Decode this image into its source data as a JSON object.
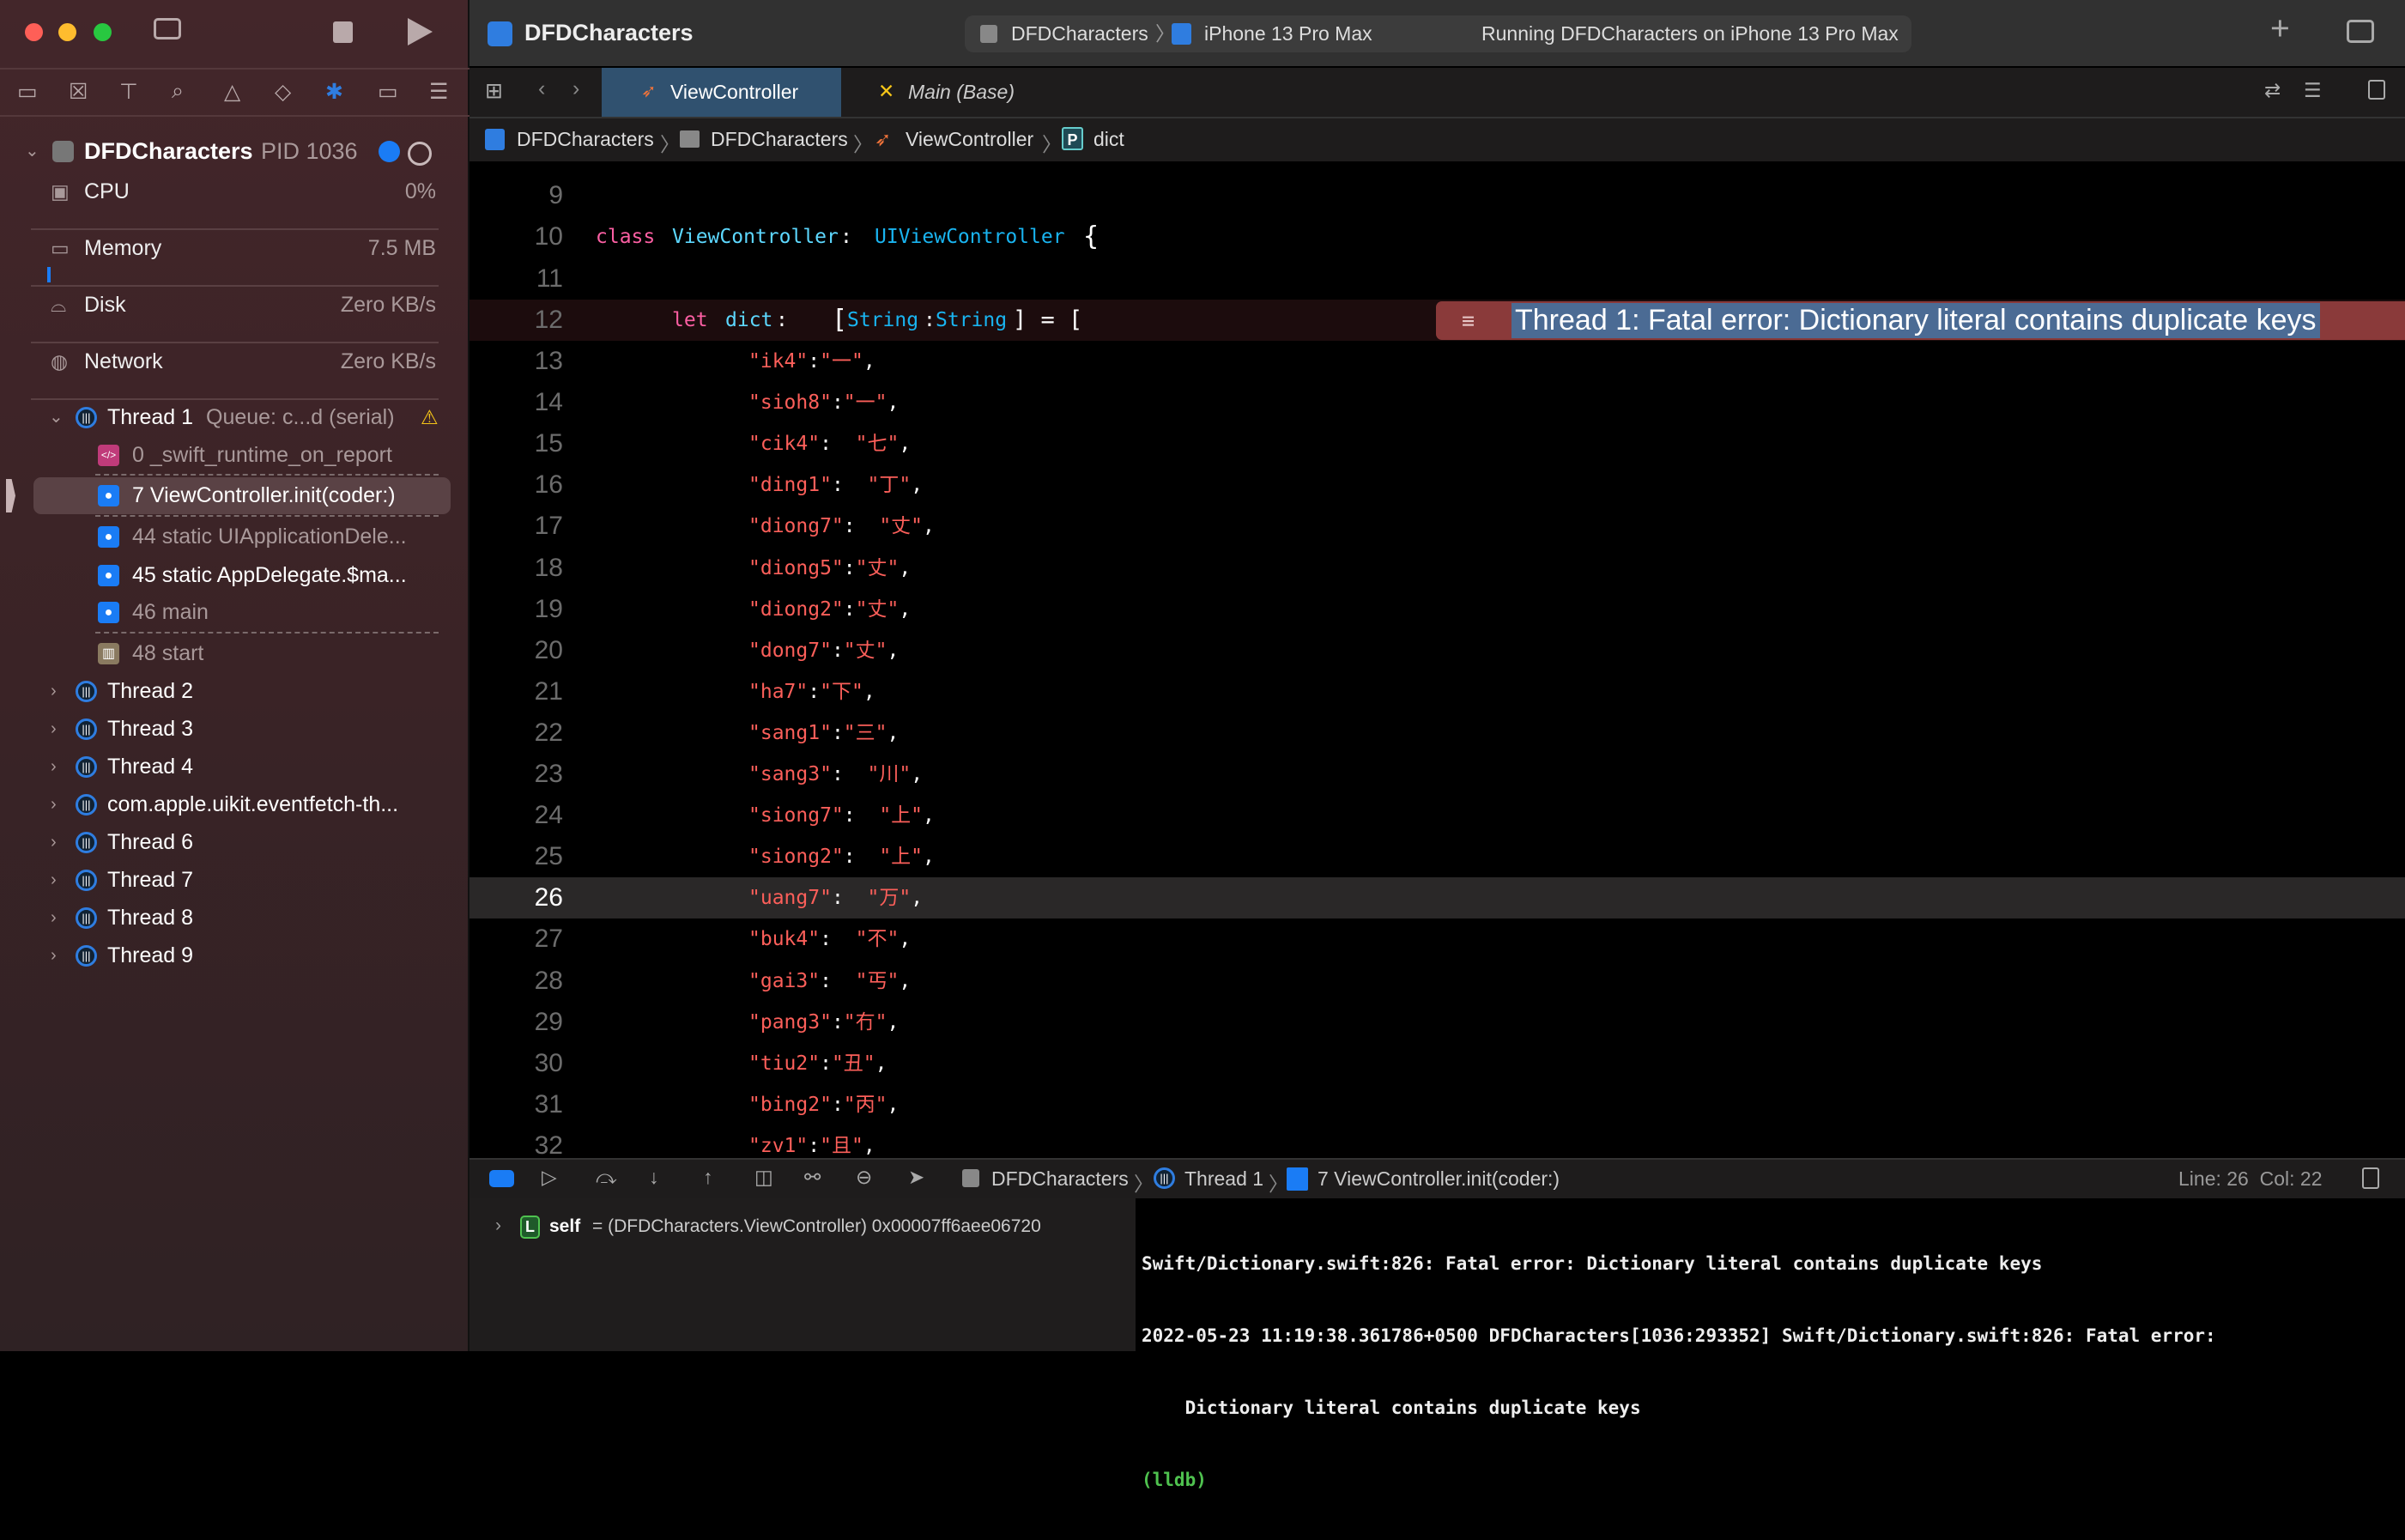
{
  "window": {
    "title": "DFDCharacters"
  },
  "toolbar": {
    "scheme": "DFDCharacters",
    "device": "iPhone 13 Pro Max",
    "status": "Running DFDCharacters on iPhone 13 Pro Max"
  },
  "tabs": [
    {
      "label": "ViewController",
      "active": true,
      "icon": "swift-icon"
    },
    {
      "label": "Main (Base)",
      "active": false,
      "icon": "storyboard-icon"
    }
  ],
  "breadcrumb": [
    "DFDCharacters",
    "DFDCharacters",
    "ViewController",
    "dict"
  ],
  "navigator": {
    "process": {
      "name": "DFDCharacters",
      "pid": "PID 1036"
    },
    "gauges": [
      {
        "label": "CPU",
        "value": "0%",
        "icon": "cpu-icon"
      },
      {
        "label": "Memory",
        "value": "7.5 MB",
        "icon": "memory-icon"
      },
      {
        "label": "Disk",
        "value": "Zero KB/s",
        "icon": "disk-icon"
      },
      {
        "label": "Network",
        "value": "Zero KB/s",
        "icon": "network-icon"
      }
    ],
    "thread1": {
      "label": "Thread 1",
      "queue": "Queue: c...d (serial)"
    },
    "frames": [
      {
        "label": "0 _swift_runtime_on_report",
        "kind": "code"
      },
      {
        "label": "7 ViewController.init(coder:)",
        "kind": "user",
        "selected": true
      },
      {
        "label": "44 static UIApplicationDele...",
        "kind": "user"
      },
      {
        "label": "45 static AppDelegate.$ma...",
        "kind": "user"
      },
      {
        "label": "46 main",
        "kind": "user"
      },
      {
        "label": "48 start",
        "kind": "library"
      }
    ],
    "threads": [
      "Thread 2",
      "Thread 3",
      "Thread 4",
      "com.apple.uikit.eventfetch-th...",
      "Thread 6",
      "Thread 7",
      "Thread 8",
      "Thread 9"
    ]
  },
  "editor": {
    "line9": "9",
    "line10": {
      "n": "10",
      "kw": "class",
      "name": "ViewController",
      "colon": ":",
      "super": "UIViewController",
      "brace": "{"
    },
    "line11": "11",
    "line12": {
      "n": "12",
      "kw": "let",
      "name": "dict",
      "colon": " :",
      "type1": "String",
      "sep": ":",
      "type2": "String",
      "rest": "] = [",
      "open": "["
    },
    "error": "Thread 1: Fatal error: Dictionary literal contains duplicate keys",
    "entries": [
      {
        "n": "13",
        "key": "\"ik4\"",
        "colon": ":",
        "val": "\"一\""
      },
      {
        "n": "14",
        "key": "\"sioh8\"",
        "colon": ":",
        "val": "\"一\""
      },
      {
        "n": "15",
        "key": "\"cik4\"",
        "colon": ":  ",
        "val": "\"七\""
      },
      {
        "n": "16",
        "key": "\"ding1\"",
        "colon": ":  ",
        "val": "\"丁\""
      },
      {
        "n": "17",
        "key": "\"diong7\"",
        "colon": ":  ",
        "val": "\"丈\""
      },
      {
        "n": "18",
        "key": "\"diong5\"",
        "colon": ":",
        "val": "\"丈\""
      },
      {
        "n": "19",
        "key": "\"diong2\"",
        "colon": ":",
        "val": "\"丈\""
      },
      {
        "n": "20",
        "key": "\"dong7\"",
        "colon": ":",
        "val": "\"丈\""
      },
      {
        "n": "21",
        "key": "\"ha7\"",
        "colon": ":",
        "val": "\"下\""
      },
      {
        "n": "22",
        "key": "\"sang1\"",
        "colon": ":",
        "val": "\"三\""
      },
      {
        "n": "23",
        "key": "\"sang3\"",
        "colon": ":  ",
        "val": "\"川\""
      },
      {
        "n": "24",
        "key": "\"siong7\"",
        "colon": ":  ",
        "val": "\"上\""
      },
      {
        "n": "25",
        "key": "\"siong2\"",
        "colon": ":  ",
        "val": "\"上\""
      },
      {
        "n": "26",
        "key": "\"uang7\"",
        "colon": ":  ",
        "val": "\"万\"",
        "current": true
      },
      {
        "n": "27",
        "key": "\"buk4\"",
        "colon": ":  ",
        "val": "\"不\""
      },
      {
        "n": "28",
        "key": "\"gai3\"",
        "colon": ":  ",
        "val": "\"丐\""
      },
      {
        "n": "29",
        "key": "\"pang3\"",
        "colon": ":",
        "val": "\"冇\""
      },
      {
        "n": "30",
        "key": "\"tiu2\"",
        "colon": ":",
        "val": "\"丑\""
      },
      {
        "n": "31",
        "key": "\"bing2\"",
        "colon": ":",
        "val": "\"丙\""
      },
      {
        "n": "32",
        "key": "\"zv1\"",
        "colon": ":",
        "val": "\"且\""
      }
    ]
  },
  "debugbar": {
    "crumbs": [
      "DFDCharacters",
      "Thread 1",
      "7 ViewController.init(coder:)"
    ],
    "position": "Line: 26  Col: 22"
  },
  "variables": [
    {
      "badge": "L",
      "name": "self",
      "value": "= (DFDCharacters.ViewController) 0x00007ff6aee06720"
    }
  ],
  "console": {
    "lines": [
      "Swift/Dictionary.swift:826: Fatal error: Dictionary literal contains duplicate keys",
      "2022-05-23 11:19:38.361786+0500 DFDCharacters[1036:293352] Swift/Dictionary.swift:826: Fatal error:",
      "    Dictionary literal contains duplicate keys"
    ],
    "prompt": "(lldb)"
  },
  "colors": {
    "accent": "#2f7de0",
    "string": "#fc5f5a",
    "keyword": "#fc5fa3",
    "type": "#5dd8ff",
    "error": "#8a3a3a",
    "lldb": "#4fc24f"
  }
}
